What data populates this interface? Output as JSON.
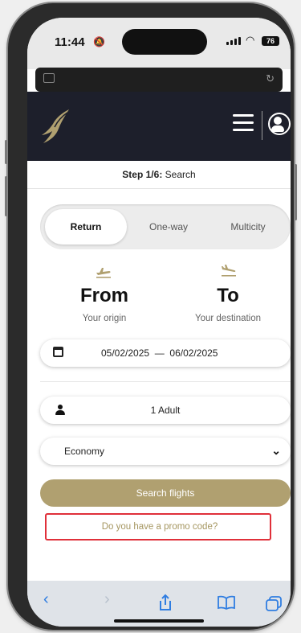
{
  "status": {
    "time": "11:44",
    "battery": "76"
  },
  "header": {
    "menu_icon": "hamburger-menu-icon",
    "account_icon": "account-icon",
    "logo_icon": "falcon-logo-icon"
  },
  "step": {
    "prefix": "Step 1/6:",
    "label": "Search"
  },
  "trip_types": {
    "options": [
      "Return",
      "One-way",
      "Multicity"
    ],
    "selected": "Return"
  },
  "from": {
    "title": "From",
    "subtitle": "Your origin",
    "icon": "plane-takeoff-icon"
  },
  "to": {
    "title": "To",
    "subtitle": "Your destination",
    "icon": "plane-landing-icon"
  },
  "dates": {
    "start": "05/02/2025",
    "separator": "—",
    "end": "06/02/2025",
    "icon": "calendar-icon"
  },
  "passengers": {
    "value": "1 Adult",
    "icon": "person-icon"
  },
  "cabin": {
    "value": "Economy"
  },
  "search_button": {
    "label": "Search flights"
  },
  "promo": {
    "label": "Do you have a promo code?"
  },
  "colors": {
    "accent_gold": "#b0a070",
    "header_bg": "#1d1f2b",
    "highlight_red": "#e0303a",
    "ios_blue": "#2f7de1"
  }
}
